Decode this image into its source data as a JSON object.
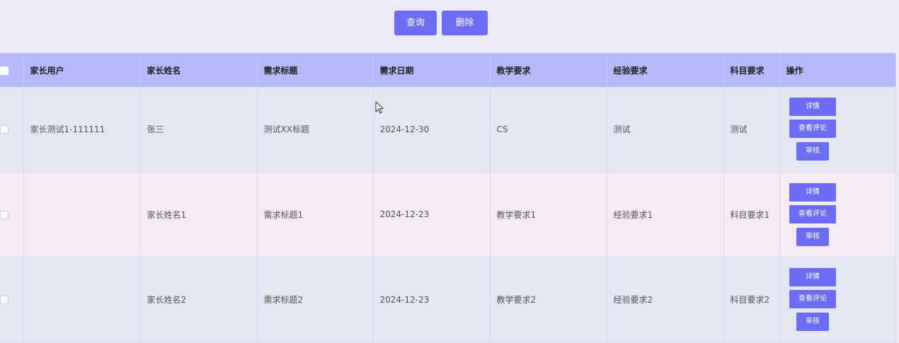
{
  "toolbar": {
    "query_label": "查询",
    "delete_label": "删除"
  },
  "table": {
    "headers": [
      "家长用户",
      "家长姓名",
      "需求标题",
      "需求日期",
      "教学要求",
      "经验要求",
      "科目要求",
      "操作"
    ],
    "rows": [
      {
        "user": "家长测试1-111111",
        "name": "张三",
        "title": "测试XX标题",
        "date": "2024-12-30",
        "teach": "CS",
        "exp": "测试",
        "subject": "测试"
      },
      {
        "user": "",
        "name": "家长姓名1",
        "title": "需求标题1",
        "date": "2024-12-23",
        "teach": "教学要求1",
        "exp": "经验要求1",
        "subject": "科目要求1"
      },
      {
        "user": "",
        "name": "家长姓名2",
        "title": "需求标题2",
        "date": "2024-12-23",
        "teach": "教学要求2",
        "exp": "经验要求2",
        "subject": "科目要求2"
      }
    ],
    "actions": {
      "detail": "详情",
      "comments": "查看评论",
      "audit": "审核"
    }
  },
  "colors": {
    "accent": "#6c6cf7",
    "header_bg": "#b6b9fd",
    "page_bg": "#ecebf7",
    "row_alt_bg": "#f6eaf4"
  }
}
